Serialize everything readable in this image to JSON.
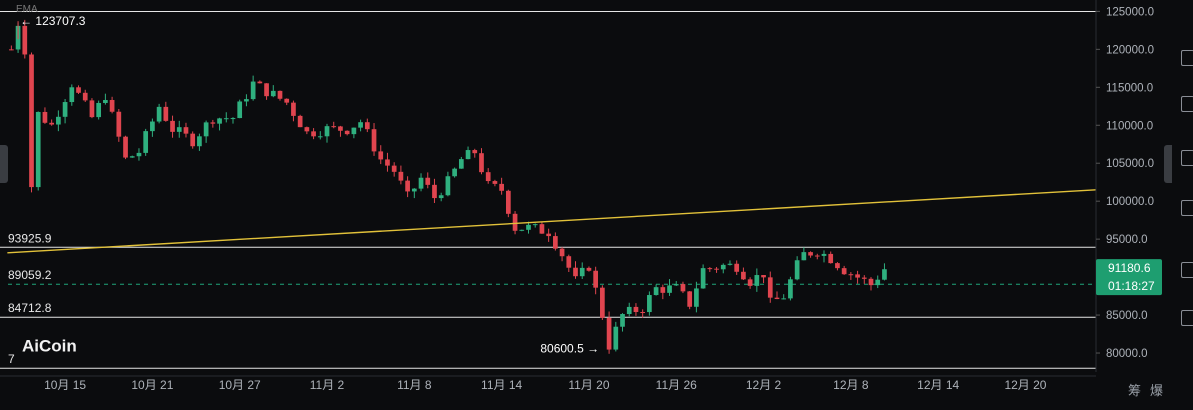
{
  "chart_data": {
    "type": "candlestick",
    "indicator_label": "EMA",
    "watermark": "AiCoin",
    "y_range": [
      77500,
      126500
    ],
    "y_ticks": [
      80000,
      85000,
      90000,
      95000,
      100000,
      105000,
      110000,
      115000,
      120000,
      125000
    ],
    "y_tick_labels": [
      "80000.0",
      "85000.0",
      "90000.0",
      "95000.0",
      "100000.0",
      "105000.0",
      "110000.0",
      "115000.0",
      "120000.0",
      "125000.0"
    ],
    "x_tick_labels": [
      "10月 15",
      "10月 21",
      "10月 27",
      "11月 2",
      "11月 8",
      "11月 14",
      "11月 20",
      "11月 26",
      "12月 2",
      "12月 8",
      "12月 14",
      "12月 20"
    ],
    "x_tick_index": [
      8,
      21,
      34,
      47,
      60,
      73,
      86,
      99,
      112,
      125,
      138,
      151
    ],
    "total_slots": 162,
    "horizontal_levels": [
      {
        "value": 124990,
        "label": ""
      },
      {
        "value": 93925.9,
        "label": "93925.9"
      },
      {
        "value": 89059.2,
        "label": "89059.2",
        "dashed": true
      },
      {
        "value": 84712.8,
        "label": "84712.8"
      },
      {
        "value": 78000,
        "label": "7"
      }
    ],
    "trendline": {
      "start": {
        "index": 0,
        "value": 93200
      },
      "end": {
        "index": 162,
        "value": 101500
      }
    },
    "annotations": {
      "high": {
        "value": 123707.3,
        "text": "← 123707.3",
        "index": 1
      },
      "low": {
        "value": 80600.5,
        "text": "80600.5 →",
        "index": 88
      }
    },
    "last_price": {
      "value": 91180.6,
      "label": "91180.6",
      "countdown": "01:18:27"
    },
    "anchors": [
      [
        0,
        120000
      ],
      [
        1,
        123500
      ],
      [
        2,
        120000
      ],
      [
        3,
        102000
      ],
      [
        4,
        111500
      ],
      [
        6,
        110000
      ],
      [
        9,
        115500
      ],
      [
        12,
        111000
      ],
      [
        14,
        114000
      ],
      [
        17,
        105500
      ],
      [
        19,
        106500
      ],
      [
        22,
        112500
      ],
      [
        24,
        109500
      ],
      [
        27,
        108000
      ],
      [
        30,
        111000
      ],
      [
        33,
        111000
      ],
      [
        36,
        115500
      ],
      [
        38,
        114500
      ],
      [
        41,
        113000
      ],
      [
        44,
        109000
      ],
      [
        47,
        109500
      ],
      [
        50,
        109500
      ],
      [
        52,
        110500
      ],
      [
        55,
        105500
      ],
      [
        57,
        104000
      ],
      [
        59,
        100500
      ],
      [
        61,
        103000
      ],
      [
        63,
        100500
      ],
      [
        65,
        102500
      ],
      [
        67,
        105500
      ],
      [
        69,
        106500
      ],
      [
        71,
        102000
      ],
      [
        73,
        101500
      ],
      [
        75,
        96500
      ],
      [
        77,
        96500
      ],
      [
        80,
        96000
      ],
      [
        82,
        93000
      ],
      [
        84,
        89500
      ],
      [
        86,
        91500
      ],
      [
        88,
        85000
      ],
      [
        89,
        81000
      ],
      [
        91,
        85000
      ],
      [
        94,
        86000
      ],
      [
        96,
        88500
      ],
      [
        99,
        88500
      ],
      [
        101,
        86500
      ],
      [
        103,
        91000
      ],
      [
        106,
        91500
      ],
      [
        108,
        91500
      ],
      [
        110,
        89500
      ],
      [
        112,
        90500
      ],
      [
        113,
        86500
      ],
      [
        115,
        87500
      ],
      [
        117,
        91500
      ],
      [
        118,
        93000
      ],
      [
        120,
        93500
      ],
      [
        122,
        92500
      ],
      [
        124,
        91000
      ],
      [
        126,
        90000
      ],
      [
        128,
        89000
      ],
      [
        130,
        91100
      ]
    ]
  },
  "bottom_tabs": [
    "筹",
    "爆"
  ]
}
